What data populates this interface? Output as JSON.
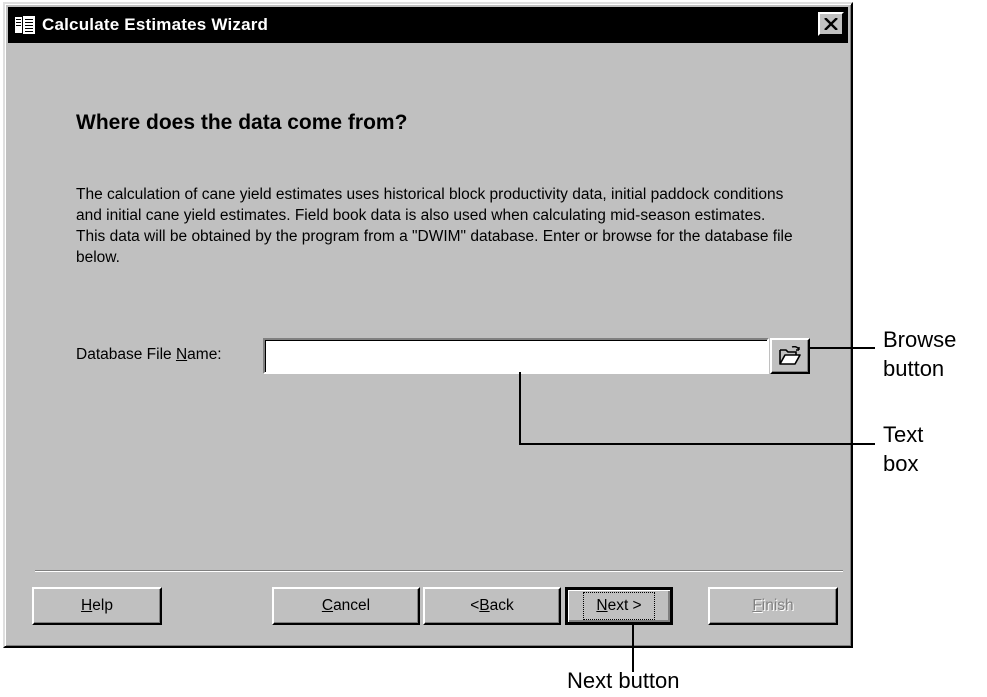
{
  "window": {
    "title": "Calculate Estimates Wizard",
    "close_label": "✕"
  },
  "content": {
    "heading": "Where does the data come from?",
    "description": "The calculation of cane yield estimates uses historical block productivity data, initial paddock conditions and initial cane yield estimates.  Field book data is also used when calculating mid-season estimates.  This data will be obtained by the program from a \"DWIM\" database.  Enter or browse for the database file below.",
    "db_label_pre": "Database File ",
    "db_label_ul": "N",
    "db_label_post": "ame:",
    "db_value": "",
    "browse_icon": "open-folder-icon"
  },
  "buttons": {
    "help": {
      "ul": "H",
      "rest": "elp"
    },
    "cancel": {
      "ul": "C",
      "rest": "ancel"
    },
    "back": {
      "pre": "< ",
      "ul": "B",
      "rest": "ack"
    },
    "next": {
      "ul": "N",
      "rest": "ext >"
    },
    "finish": {
      "ul": "F",
      "rest": "inish"
    }
  },
  "callouts": {
    "browse": [
      "Browse",
      "button"
    ],
    "textbox": [
      "Text",
      "box"
    ],
    "next": "Next button"
  }
}
